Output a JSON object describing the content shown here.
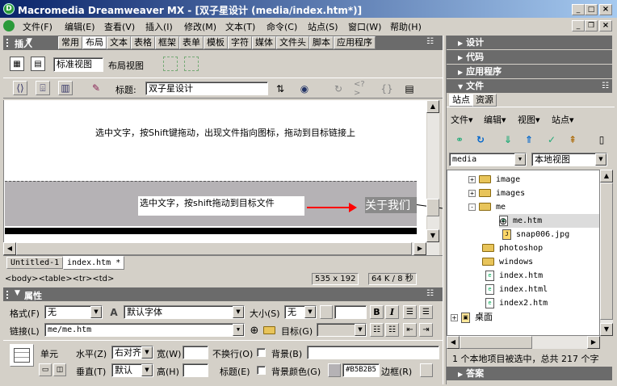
{
  "window": {
    "title": "Macromedia Dreamweaver MX - [双子星设计 (media/index.htm*)]",
    "controls": [
      "_",
      "□",
      "×"
    ]
  },
  "menu": {
    "items": [
      "文件(F)",
      "编辑(E)",
      "查看(V)",
      "插入(I)",
      "修改(M)",
      "文本(T)",
      "命令(C)",
      "站点(S)",
      "窗口(W)",
      "帮助(H)"
    ]
  },
  "insert_bar": {
    "title": "插入",
    "tabs": [
      "常用",
      "布局",
      "文本",
      "表格",
      "框架",
      "表单",
      "模板",
      "字符",
      "媒体",
      "文件头",
      "脚本",
      "应用程序"
    ]
  },
  "layout_row": {
    "standard_view": "标准视图",
    "layout_view": "布局视图"
  },
  "doc_toolbar": {
    "title_label": "标题:",
    "title_value": "双子星设计"
  },
  "canvas": {
    "top_text": "选中文字，按Shift键拖动，出现文件指向图标，拖动到目标链接上",
    "box_text": "选中文字，按shift拖动到目标文件",
    "link_text": "关于我们"
  },
  "doc_tabs": [
    "Untitled-1",
    "index.htm *"
  ],
  "status_bar": {
    "tags": "<body><table><tr><td>",
    "size": "535 x 192",
    "weight": "64 K / 8 秒"
  },
  "properties": {
    "title": "属性",
    "format_label": "格式(F)",
    "format_value": "无",
    "font_value": "默认字体",
    "size_label": "大小(S)",
    "size_value": "无",
    "link_label": "链接(L)",
    "link_value": "me/me.htm",
    "target_label": "目标(G)",
    "cell_label": "单元",
    "horz_label": "水平(Z)",
    "horz_value": "右对齐",
    "width_label": "宽(W)",
    "nowrap_label": "不换行(O)",
    "bg_label": "背景(B)",
    "vert_label": "垂直(T)",
    "vert_value": "默认",
    "height_label": "高(H)",
    "header_label": "标题(E)",
    "bgcolor_label": "背景颜色(G)",
    "bgcolor_value": "#B5B2B5",
    "border_label": "边框(R)"
  },
  "right_panels": {
    "design": "设计",
    "code": "代码",
    "app": "应用程序",
    "files": "文件",
    "tabs": [
      "站点",
      "资源"
    ],
    "menus": [
      "文件",
      "编辑",
      "视图",
      "站点"
    ],
    "site_select": "media",
    "view_select": "本地视图",
    "tree": [
      {
        "name": "image",
        "type": "folder",
        "indent": 1,
        "expander": "+"
      },
      {
        "name": "images",
        "type": "folder",
        "indent": 1,
        "expander": "+"
      },
      {
        "name": "me",
        "type": "folder",
        "indent": 1,
        "expander": "-"
      },
      {
        "name": "me.htm",
        "type": "htm",
        "indent": 2,
        "selected": true
      },
      {
        "name": "snap006.jpg",
        "type": "jpg",
        "indent": 2
      },
      {
        "name": "photoshop",
        "type": "folder",
        "indent": 1
      },
      {
        "name": "windows",
        "type": "folder",
        "indent": 1
      },
      {
        "name": "index.htm",
        "type": "htm",
        "indent": 1
      },
      {
        "name": "index.html",
        "type": "htm",
        "indent": 1
      },
      {
        "name": "index2.htm",
        "type": "htm",
        "indent": 1
      }
    ],
    "desktop": "桌面",
    "status": "1 个本地项目被选中，总共 217 个字",
    "answer": "答案"
  },
  "colors": {
    "titlebar": "#0a246a",
    "panel_head": "#6b6b6b",
    "canvas_gray": "#b5b2b5",
    "arrow": "#ff0000"
  }
}
